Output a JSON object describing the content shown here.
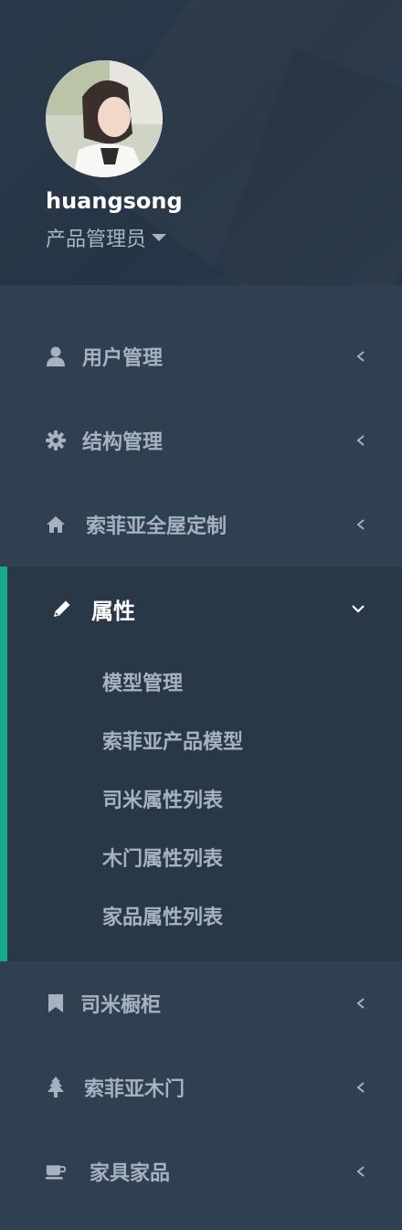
{
  "profile": {
    "username": "huangsong",
    "role": "产品管理员"
  },
  "menu": {
    "items": [
      {
        "label": "用户管理",
        "icon": "user-icon"
      },
      {
        "label": "结构管理",
        "icon": "gear-icon"
      },
      {
        "label": "索菲亚全屋定制",
        "icon": "home-icon"
      },
      {
        "label": "属性",
        "icon": "pencil-icon",
        "expanded": true,
        "children": [
          "模型管理",
          "索菲亚产品模型",
          "司米属性列表",
          "木门属性列表",
          "家品属性列表"
        ]
      },
      {
        "label": "司米橱柜",
        "icon": "bookmark-icon"
      },
      {
        "label": "索菲亚木门",
        "icon": "tree-icon"
      },
      {
        "label": "家具家品",
        "icon": "coffee-icon"
      }
    ]
  },
  "colors": {
    "sidebar_bg": "#2f4050",
    "active_bg": "#293846",
    "accent": "#19aa8d",
    "text": "#a7b1c2"
  }
}
